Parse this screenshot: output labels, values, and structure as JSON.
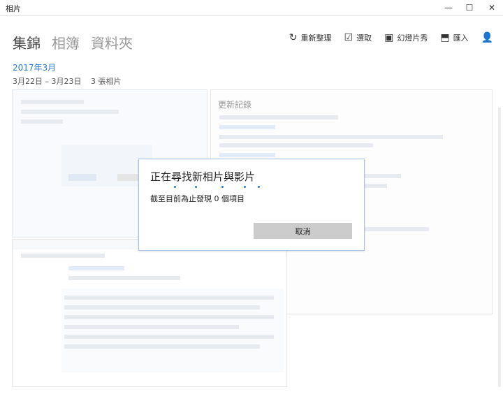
{
  "window": {
    "title": "相片"
  },
  "window_controls": {
    "minimize": "—",
    "maximize": "☐",
    "close": "✕"
  },
  "nav": {
    "collection": "集錦",
    "albums": "相簿",
    "folders": "資料夾"
  },
  "toolbar": {
    "refresh": "重新整理",
    "select": "選取",
    "slideshow": "幻燈片秀",
    "import": "匯入"
  },
  "icons": {
    "refresh": "↻",
    "select": "☑",
    "slideshow": "▣",
    "import": "⬒",
    "account": "👤"
  },
  "group": {
    "month": "2017年3月",
    "range": "3月22日 – 3月23日",
    "count": "3 張相片"
  },
  "dialog": {
    "title": "正在尋找新相片與影片",
    "status": "截至目前為止發現 0 個項目",
    "cancel": "取消"
  },
  "thumb2": {
    "heading": "更新記錄"
  },
  "colors": {
    "accent": "#2b7bd3",
    "dialog_border": "#a7c3e6",
    "cancel_bg": "#cccccc"
  }
}
